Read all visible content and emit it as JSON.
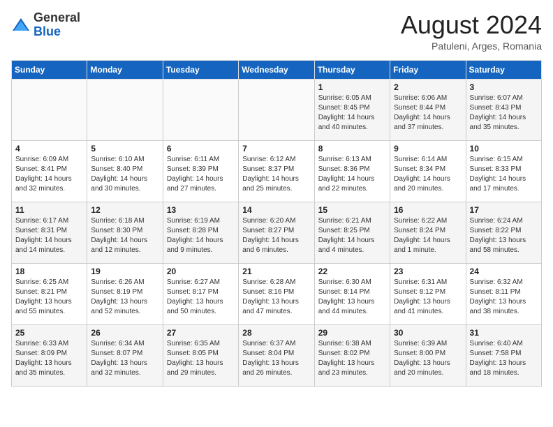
{
  "header": {
    "logo_line1": "General",
    "logo_line2": "Blue",
    "month_year": "August 2024",
    "location": "Patuleni, Arges, Romania"
  },
  "weekdays": [
    "Sunday",
    "Monday",
    "Tuesday",
    "Wednesday",
    "Thursday",
    "Friday",
    "Saturday"
  ],
  "weeks": [
    [
      {
        "day": "",
        "info": ""
      },
      {
        "day": "",
        "info": ""
      },
      {
        "day": "",
        "info": ""
      },
      {
        "day": "",
        "info": ""
      },
      {
        "day": "1",
        "info": "Sunrise: 6:05 AM\nSunset: 8:45 PM\nDaylight: 14 hours\nand 40 minutes."
      },
      {
        "day": "2",
        "info": "Sunrise: 6:06 AM\nSunset: 8:44 PM\nDaylight: 14 hours\nand 37 minutes."
      },
      {
        "day": "3",
        "info": "Sunrise: 6:07 AM\nSunset: 8:43 PM\nDaylight: 14 hours\nand 35 minutes."
      }
    ],
    [
      {
        "day": "4",
        "info": "Sunrise: 6:09 AM\nSunset: 8:41 PM\nDaylight: 14 hours\nand 32 minutes."
      },
      {
        "day": "5",
        "info": "Sunrise: 6:10 AM\nSunset: 8:40 PM\nDaylight: 14 hours\nand 30 minutes."
      },
      {
        "day": "6",
        "info": "Sunrise: 6:11 AM\nSunset: 8:39 PM\nDaylight: 14 hours\nand 27 minutes."
      },
      {
        "day": "7",
        "info": "Sunrise: 6:12 AM\nSunset: 8:37 PM\nDaylight: 14 hours\nand 25 minutes."
      },
      {
        "day": "8",
        "info": "Sunrise: 6:13 AM\nSunset: 8:36 PM\nDaylight: 14 hours\nand 22 minutes."
      },
      {
        "day": "9",
        "info": "Sunrise: 6:14 AM\nSunset: 8:34 PM\nDaylight: 14 hours\nand 20 minutes."
      },
      {
        "day": "10",
        "info": "Sunrise: 6:15 AM\nSunset: 8:33 PM\nDaylight: 14 hours\nand 17 minutes."
      }
    ],
    [
      {
        "day": "11",
        "info": "Sunrise: 6:17 AM\nSunset: 8:31 PM\nDaylight: 14 hours\nand 14 minutes."
      },
      {
        "day": "12",
        "info": "Sunrise: 6:18 AM\nSunset: 8:30 PM\nDaylight: 14 hours\nand 12 minutes."
      },
      {
        "day": "13",
        "info": "Sunrise: 6:19 AM\nSunset: 8:28 PM\nDaylight: 14 hours\nand 9 minutes."
      },
      {
        "day": "14",
        "info": "Sunrise: 6:20 AM\nSunset: 8:27 PM\nDaylight: 14 hours\nand 6 minutes."
      },
      {
        "day": "15",
        "info": "Sunrise: 6:21 AM\nSunset: 8:25 PM\nDaylight: 14 hours\nand 4 minutes."
      },
      {
        "day": "16",
        "info": "Sunrise: 6:22 AM\nSunset: 8:24 PM\nDaylight: 14 hours\nand 1 minute."
      },
      {
        "day": "17",
        "info": "Sunrise: 6:24 AM\nSunset: 8:22 PM\nDaylight: 13 hours\nand 58 minutes."
      }
    ],
    [
      {
        "day": "18",
        "info": "Sunrise: 6:25 AM\nSunset: 8:21 PM\nDaylight: 13 hours\nand 55 minutes."
      },
      {
        "day": "19",
        "info": "Sunrise: 6:26 AM\nSunset: 8:19 PM\nDaylight: 13 hours\nand 52 minutes."
      },
      {
        "day": "20",
        "info": "Sunrise: 6:27 AM\nSunset: 8:17 PM\nDaylight: 13 hours\nand 50 minutes."
      },
      {
        "day": "21",
        "info": "Sunrise: 6:28 AM\nSunset: 8:16 PM\nDaylight: 13 hours\nand 47 minutes."
      },
      {
        "day": "22",
        "info": "Sunrise: 6:30 AM\nSunset: 8:14 PM\nDaylight: 13 hours\nand 44 minutes."
      },
      {
        "day": "23",
        "info": "Sunrise: 6:31 AM\nSunset: 8:12 PM\nDaylight: 13 hours\nand 41 minutes."
      },
      {
        "day": "24",
        "info": "Sunrise: 6:32 AM\nSunset: 8:11 PM\nDaylight: 13 hours\nand 38 minutes."
      }
    ],
    [
      {
        "day": "25",
        "info": "Sunrise: 6:33 AM\nSunset: 8:09 PM\nDaylight: 13 hours\nand 35 minutes."
      },
      {
        "day": "26",
        "info": "Sunrise: 6:34 AM\nSunset: 8:07 PM\nDaylight: 13 hours\nand 32 minutes."
      },
      {
        "day": "27",
        "info": "Sunrise: 6:35 AM\nSunset: 8:05 PM\nDaylight: 13 hours\nand 29 minutes."
      },
      {
        "day": "28",
        "info": "Sunrise: 6:37 AM\nSunset: 8:04 PM\nDaylight: 13 hours\nand 26 minutes."
      },
      {
        "day": "29",
        "info": "Sunrise: 6:38 AM\nSunset: 8:02 PM\nDaylight: 13 hours\nand 23 minutes."
      },
      {
        "day": "30",
        "info": "Sunrise: 6:39 AM\nSunset: 8:00 PM\nDaylight: 13 hours\nand 20 minutes."
      },
      {
        "day": "31",
        "info": "Sunrise: 6:40 AM\nSunset: 7:58 PM\nDaylight: 13 hours\nand 18 minutes."
      }
    ]
  ]
}
